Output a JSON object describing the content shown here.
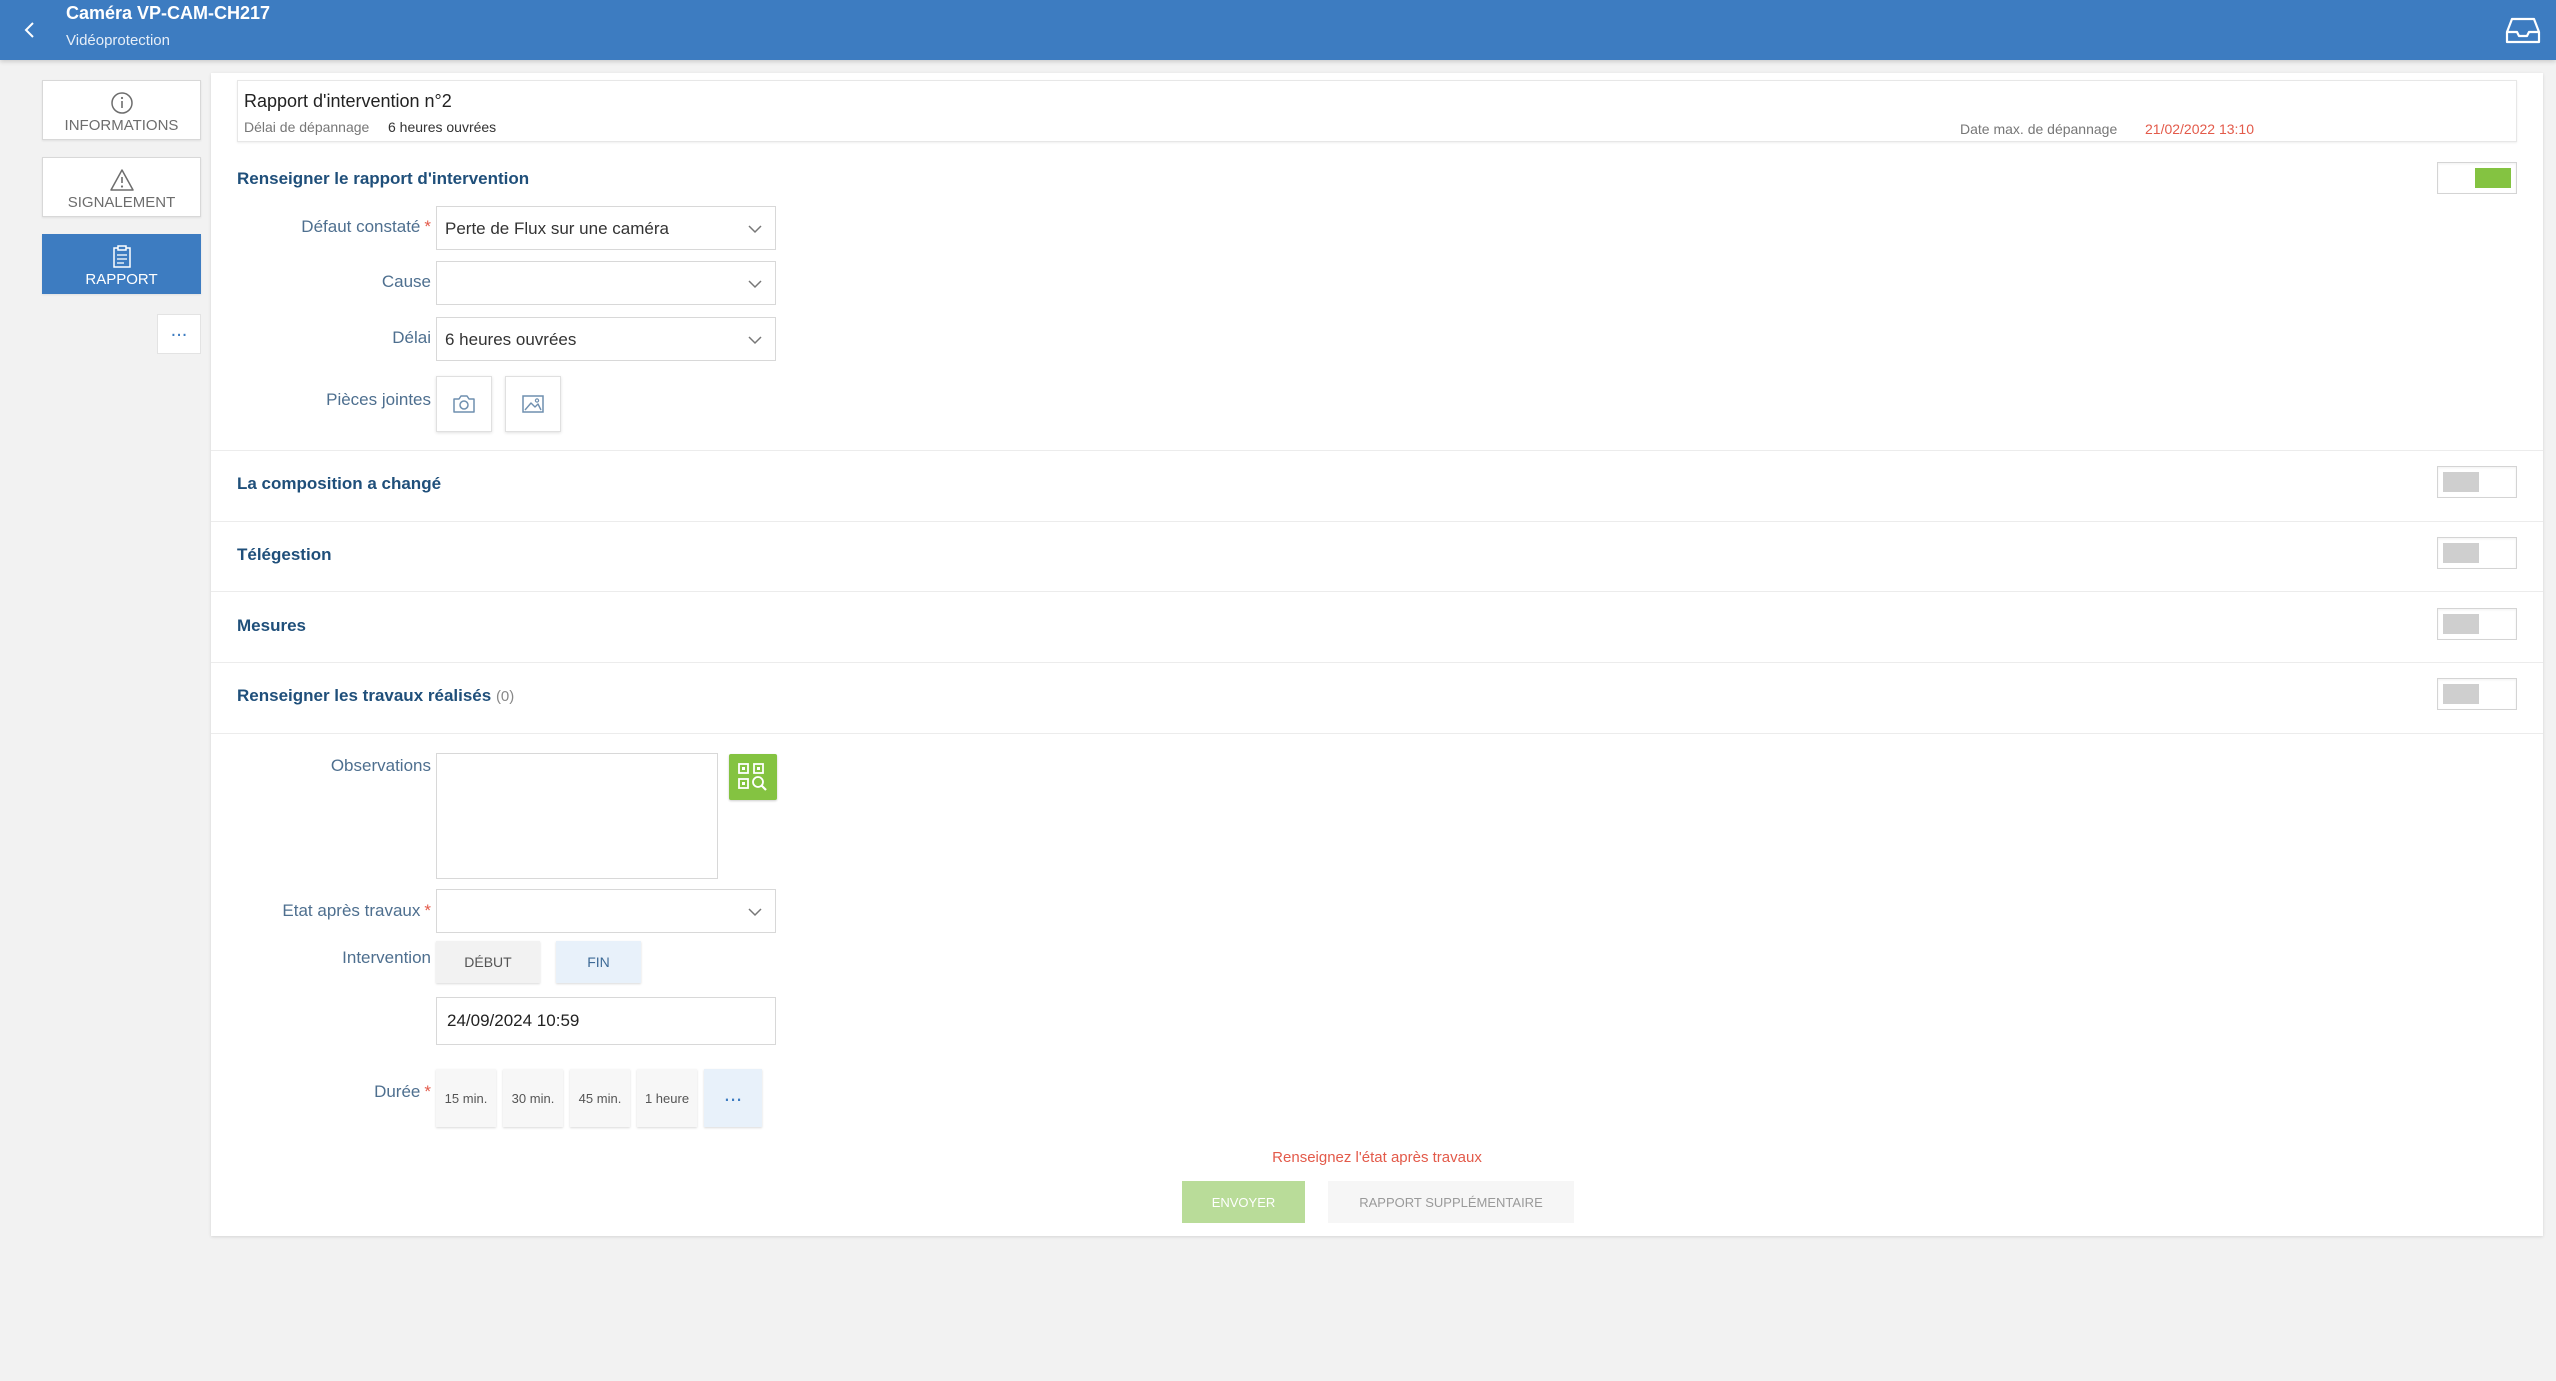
{
  "header": {
    "title": "Caméra VP-CAM-CH217",
    "subtitle": "Vidéoprotection"
  },
  "nav": {
    "items": [
      {
        "label": "INFORMATIONS",
        "icon": "info-icon"
      },
      {
        "label": "SIGNALEMENT",
        "icon": "warning-icon"
      },
      {
        "label": "RAPPORT",
        "icon": "clipboard-icon",
        "active": true
      }
    ],
    "more_label": "..."
  },
  "report": {
    "title": "Rapport d'intervention n°2",
    "delay_label": "Délai de dépannage",
    "delay_value": "6 heures ouvrées",
    "max_date_label": "Date max. de dépannage",
    "max_date_value": "21/02/2022 13:10"
  },
  "sections": {
    "fill_report": {
      "title": "Renseigner le rapport d'intervention",
      "enabled": true
    },
    "composition": {
      "title": "La composition a changé",
      "enabled": false
    },
    "telegestion": {
      "title": "Télégestion",
      "enabled": false
    },
    "mesures": {
      "title": "Mesures",
      "enabled": false
    },
    "travaux": {
      "title": "Renseigner les travaux réalisés",
      "count": "(0)",
      "enabled": false
    }
  },
  "form": {
    "defaut": {
      "label": "Défaut constaté",
      "required_mark": "*",
      "value": "Perte de Flux sur une caméra"
    },
    "cause": {
      "label": "Cause",
      "value": ""
    },
    "delai": {
      "label": "Délai",
      "value": "6 heures ouvrées"
    },
    "pieces": {
      "label": "Pièces jointes"
    },
    "observations": {
      "label": "Observations",
      "value": ""
    },
    "etat": {
      "label": "Etat après travaux",
      "required_mark": "*",
      "value": ""
    },
    "intervention": {
      "label": "Intervention",
      "start_label": "DÉBUT",
      "end_label": "FIN",
      "datetime": "24/09/2024 10:59"
    },
    "duree": {
      "label": "Durée",
      "required_mark": "*",
      "options": [
        "15 min.",
        "30 min.",
        "45 min.",
        "1 heure"
      ],
      "more_label": "..."
    }
  },
  "footer": {
    "error": "Renseignez l'état après travaux",
    "send_label": "ENVOYER",
    "extra_label": "RAPPORT SUPPLÉMENTAIRE"
  },
  "colors": {
    "primary": "#3d7cc1",
    "accent_green": "#84c341",
    "error_red": "#e35a4a"
  }
}
